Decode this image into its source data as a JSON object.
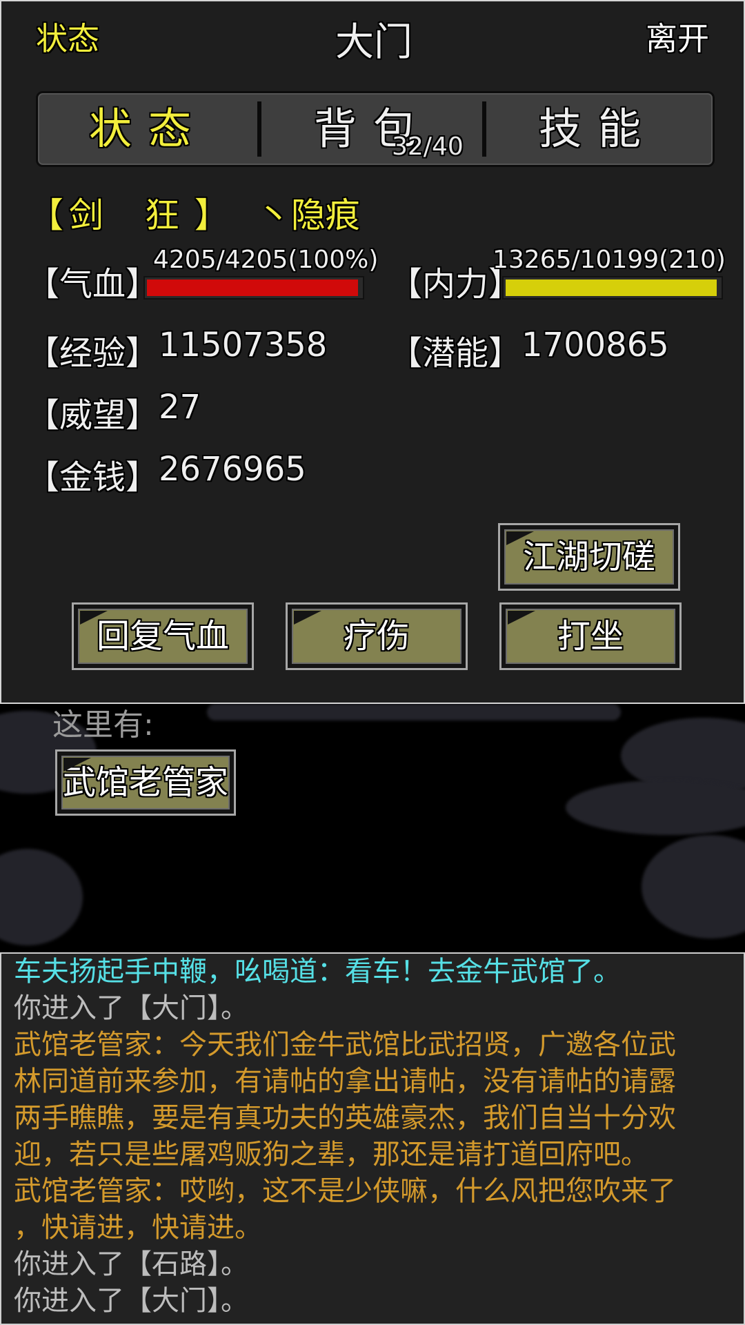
{
  "header": {
    "status_link": "状态",
    "room_title": "大门",
    "leave_link": "离开"
  },
  "tabs": {
    "status": "状态",
    "bag": "背包",
    "bag_count": "32/40",
    "skills": "技能"
  },
  "character": {
    "title_open": "【",
    "title_text": "剑 狂",
    "title_close": "】",
    "name": "丶隐痕"
  },
  "stats": {
    "hp_label": "【气血】",
    "hp_text": "4205/4205(100%)",
    "hp_fraction": 1.0,
    "hp_color": "#d10a0a",
    "mp_label": "【内力】",
    "mp_text": "13265/10199(210)",
    "mp_fraction": 1.0,
    "mp_color": "#d6cf0a",
    "exp_label": "【经验】",
    "exp_value": "11507358",
    "pot_label": "【潜能】",
    "pot_value": "1700865",
    "prestige_label": "【威望】",
    "prestige_value": "27",
    "money_label": "【金钱】",
    "money_value": "2676965"
  },
  "actions": {
    "spar": "江湖切磋",
    "heal_hp": "回复气血",
    "treat": "疗伤",
    "meditate": "打坐"
  },
  "room": {
    "here_label": "这里有:",
    "npc": "武馆老管家"
  },
  "log": [
    {
      "text": "车夫扬起手中鞭，吆喝道：看车！去金牛武馆了。",
      "color": "#56e0e6"
    },
    {
      "text": "你进入了【大门】。",
      "color": "#bdbdbd"
    },
    {
      "text": "武馆老管家：今天我们金牛武馆比武招贤，广邀各位武",
      "color": "#d49a2c"
    },
    {
      "text": "林同道前来参加，有请帖的拿出请帖，没有请帖的请露",
      "color": "#d49a2c"
    },
    {
      "text": "两手瞧瞧，要是有真功夫的英雄豪杰，我们自当十分欢",
      "color": "#d49a2c"
    },
    {
      "text": "迎，若只是些屠鸡贩狗之辈，那还是请打道回府吧。",
      "color": "#d49a2c"
    },
    {
      "text": "武馆老管家：哎哟，这不是少侠嘛，什么风把您吹来了",
      "color": "#d49a2c"
    },
    {
      "text": "，快请进，快请进。",
      "color": "#d49a2c"
    },
    {
      "text": "你进入了【石路】。",
      "color": "#bdbdbd"
    },
    {
      "text": "你进入了【大门】。",
      "color": "#bdbdbd"
    }
  ]
}
